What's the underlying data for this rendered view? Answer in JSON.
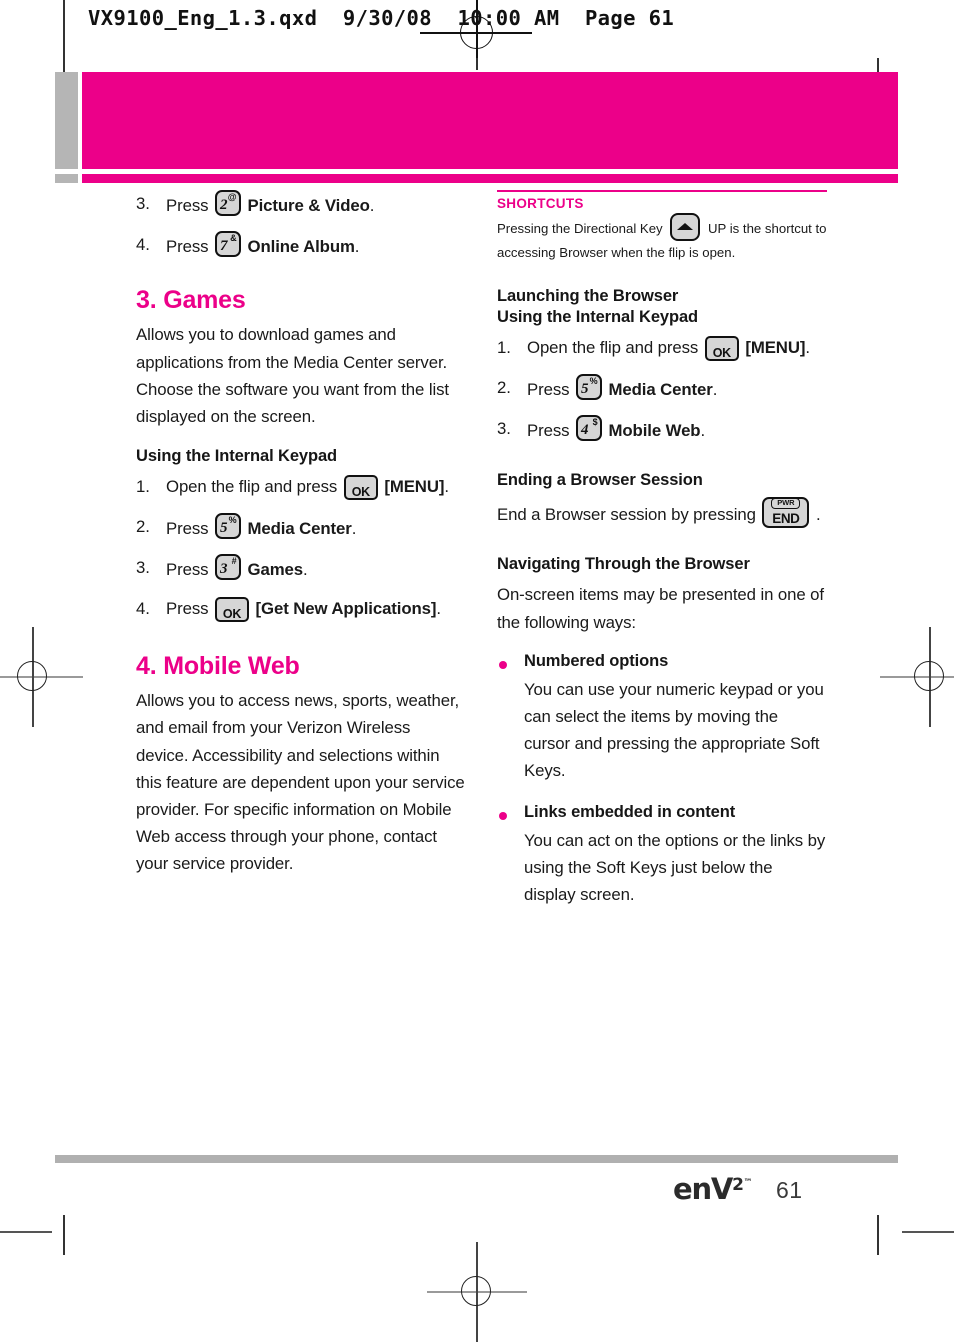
{
  "file_header": {
    "text": "VX9100_Eng_1.3.qxd  9/30/08  10:00 AM  Page 61"
  },
  "colors": {
    "magenta": "#ec0089",
    "gray_bar": "#b5b5b5",
    "text": "#1a1a1a"
  },
  "left_column": {
    "top_steps": [
      {
        "num": "3.",
        "verb": "Press",
        "key": {
          "digit": "2",
          "sup": "@"
        },
        "label": "Picture & Video",
        "period": "."
      },
      {
        "num": "4.",
        "verb": "Press",
        "key": {
          "digit": "7",
          "sup": "&"
        },
        "label": "Online Album",
        "period": "."
      }
    ],
    "games": {
      "heading": "3. Games",
      "body": "Allows you to download games and applications  from the Media Center server. Choose the software you want from the list displayed on the screen.",
      "subheading": "Using the Internal Keypad",
      "steps": [
        {
          "num": "1.",
          "pre": "Open the flip and press",
          "key_type": "ok",
          "key_label": "OK",
          "post_bold": "[MENU]",
          "period": "."
        },
        {
          "num": "2.",
          "pre": "Press",
          "key_type": "num",
          "digit": "5",
          "sup": "%",
          "post_bold": "Media Center",
          "period": "."
        },
        {
          "num": "3.",
          "pre": "Press",
          "key_type": "num",
          "digit": "3",
          "sup": "#",
          "post_bold": "Games",
          "period": "."
        },
        {
          "num": "4.",
          "pre": "Press",
          "key_type": "ok",
          "key_label": "OK",
          "post_bold": "[Get New Applications]",
          "period": "."
        }
      ]
    },
    "mobile_web": {
      "heading": "4. Mobile Web",
      "body": "Allows you to access news, sports, weather, and email from your Verizon Wireless device. Accessibility and selections within this feature are dependent upon your service provider. For specific information on Mobile Web access through your phone, contact your service provider."
    }
  },
  "right_column": {
    "shortcuts": {
      "label": "SHORTCUTS",
      "text_before": "Pressing the Directional Key",
      "key_icon": "directional-up-key",
      "text_after": "UP is the shortcut to accessing Browser when the flip is open."
    },
    "launching": {
      "heading_line1": "Launching the Browser",
      "heading_line2": "Using the Internal Keypad",
      "steps": [
        {
          "num": "1.",
          "pre": "Open the flip and press",
          "key_type": "ok",
          "key_label": "OK",
          "post_bold": "[MENU]",
          "period": "."
        },
        {
          "num": "2.",
          "pre": "Press",
          "key_type": "num",
          "digit": "5",
          "sup": "%",
          "post_bold": "Media Center",
          "period": "."
        },
        {
          "num": "3.",
          "pre": "Press",
          "key_type": "num",
          "digit": "4",
          "sup": "$",
          "post_bold": "Mobile Web",
          "period": "."
        }
      ]
    },
    "ending": {
      "heading": "Ending a Browser Session",
      "text_before": "End a Browser session by pressing",
      "key": {
        "top": "PWR",
        "main": "END"
      },
      "period": "."
    },
    "navigating": {
      "heading": "Navigating Through the Browser",
      "intro": "On-screen items may be presented in one of the following ways:",
      "bullets": [
        {
          "title": "Numbered options",
          "body": "You can use your numeric keypad or you can select the items by moving the cursor and pressing the appropriate Soft Keys."
        },
        {
          "title": "Links embedded in content",
          "body": "You can act on the options or the links by using the Soft Keys just below the display screen."
        }
      ]
    }
  },
  "footer": {
    "logo_text": "enV",
    "logo_sup": "2",
    "logo_tm": "™",
    "page_number": "61"
  }
}
